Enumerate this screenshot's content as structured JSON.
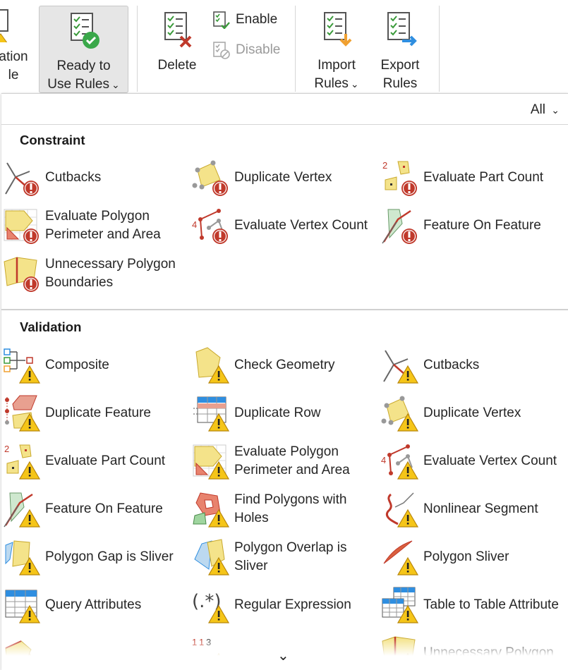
{
  "ribbon": {
    "partial_left": {
      "line1": "ation",
      "line2": "le"
    },
    "ready_to_use": {
      "line1": "Ready to",
      "line2": "Use Rules"
    },
    "delete": {
      "label": "Delete"
    },
    "enable": {
      "label": "Enable"
    },
    "disable": {
      "label": "Disable"
    },
    "import": {
      "line1": "Import",
      "line2": "Rules"
    },
    "export": {
      "line1": "Export",
      "line2": "Rules"
    }
  },
  "panel": {
    "filter_label": "All",
    "constraint": {
      "title": "Constraint",
      "items": [
        {
          "label": "Cutbacks",
          "icon": "cutbacks-icon"
        },
        {
          "label": "Duplicate Vertex",
          "icon": "duplicate-vertex-icon"
        },
        {
          "label": "Evaluate Part Count",
          "icon": "evaluate-part-count-icon"
        },
        {
          "label": "Evaluate Polygon Perimeter and Area",
          "icon": "evaluate-polygon-perimeter-area-icon"
        },
        {
          "label": "Evaluate Vertex Count",
          "icon": "evaluate-vertex-count-icon"
        },
        {
          "label": "Feature On Feature",
          "icon": "feature-on-feature-icon"
        },
        {
          "label": "Unnecessary Polygon Boundaries",
          "icon": "unnecessary-polygon-boundaries-icon"
        }
      ]
    },
    "validation": {
      "title": "Validation",
      "items": [
        {
          "label": "Composite",
          "icon": "composite-icon"
        },
        {
          "label": "Check Geometry",
          "icon": "check-geometry-icon"
        },
        {
          "label": "Cutbacks",
          "icon": "cutbacks-icon"
        },
        {
          "label": "Duplicate Feature",
          "icon": "duplicate-feature-icon"
        },
        {
          "label": "Duplicate Row",
          "icon": "duplicate-row-icon"
        },
        {
          "label": "Duplicate Vertex",
          "icon": "duplicate-vertex-icon"
        },
        {
          "label": "Evaluate Part Count",
          "icon": "evaluate-part-count-icon"
        },
        {
          "label": "Evaluate Polygon Perimeter and Area",
          "icon": "evaluate-polygon-perimeter-area-icon"
        },
        {
          "label": "Evaluate Vertex Count",
          "icon": "evaluate-vertex-count-icon"
        },
        {
          "label": "Feature On Feature",
          "icon": "feature-on-feature-icon"
        },
        {
          "label": "Find Polygons with Holes",
          "icon": "find-polygons-with-holes-icon"
        },
        {
          "label": "Nonlinear Segment",
          "icon": "nonlinear-segment-icon"
        },
        {
          "label": "Polygon Gap is Sliver",
          "icon": "polygon-gap-is-sliver-icon"
        },
        {
          "label": "Polygon Overlap is Sliver",
          "icon": "polygon-overlap-is-sliver-icon"
        },
        {
          "label": "Polygon Sliver",
          "icon": "polygon-sliver-icon"
        },
        {
          "label": "Query Attributes",
          "icon": "query-attributes-icon"
        },
        {
          "label": "Regular Expression",
          "icon": "regular-expression-icon"
        },
        {
          "label": "Table to Table Attribute",
          "icon": "table-to-table-attribute-icon"
        },
        {
          "label": "",
          "icon": "partial-rule-icon"
        },
        {
          "label": "",
          "icon": "sequence-icon"
        },
        {
          "label": "Unnecessary Polygon",
          "icon": "unnecessary-polygon-icon"
        }
      ]
    }
  },
  "colors": {
    "warning": "#f5c518",
    "error": "#c0392b",
    "polygon": "#f4e38a",
    "accent_green": "#4caf50"
  }
}
